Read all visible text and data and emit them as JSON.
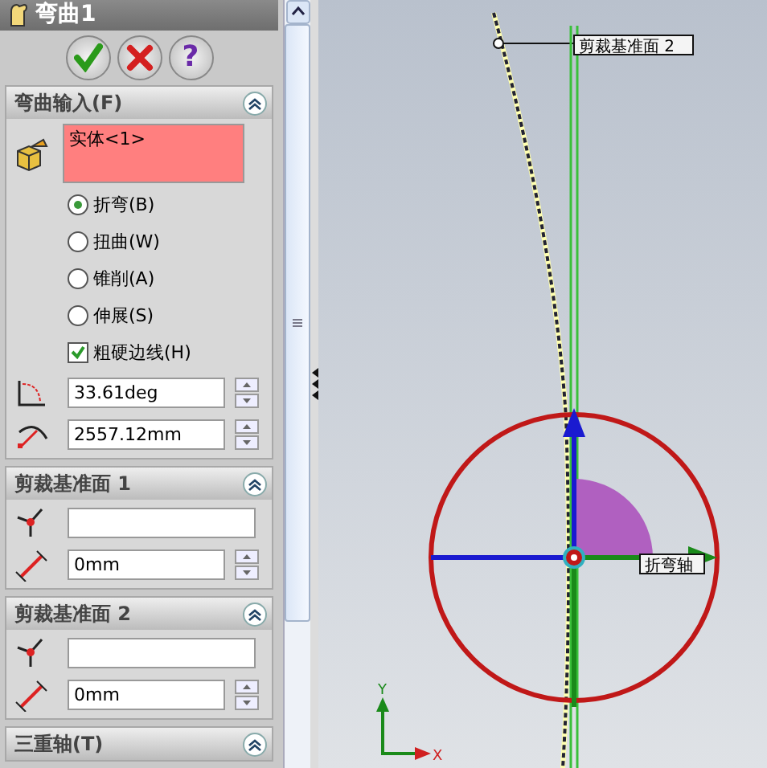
{
  "title": "弯曲1",
  "actions": [
    {
      "kind": "ok"
    },
    {
      "kind": "cancel"
    },
    {
      "kind": "help",
      "label": "?"
    }
  ],
  "sections": [
    {
      "kind": "bend",
      "title": "弯曲输入(F)",
      "expanded": true,
      "selection": "实体<1>",
      "options": [
        {
          "label": "折弯(B)",
          "selected": true
        },
        {
          "label": "扭曲(W)",
          "selected": false
        },
        {
          "label": "锥削(A)",
          "selected": false
        },
        {
          "label": "伸展(S)",
          "selected": false
        }
      ],
      "checkbox": {
        "label": "粗硬边线(H)",
        "checked": true
      },
      "fields": [
        {
          "kind": "angle",
          "value": "33.61deg"
        },
        {
          "kind": "radius",
          "value": "2557.12mm"
        }
      ]
    },
    {
      "kind": "trim",
      "title": "剪裁基准面 1",
      "expanded": true,
      "fields": [
        {
          "kind": "plane"
        },
        {
          "kind": "distance",
          "value": "0mm"
        }
      ]
    },
    {
      "kind": "trim",
      "title": "剪裁基准面 2",
      "expanded": true,
      "fields": [
        {
          "kind": "plane"
        },
        {
          "kind": "distance",
          "value": "0mm"
        }
      ]
    },
    {
      "kind": "header",
      "title": "三重轴(T)",
      "expanded": true
    }
  ],
  "viewport": {
    "labels": [
      {
        "kind": "plane",
        "text": "剪裁基准面 2"
      },
      {
        "kind": "axis",
        "text": "折弯轴"
      }
    ],
    "triad": {
      "y": "Y",
      "x": "X"
    }
  }
}
